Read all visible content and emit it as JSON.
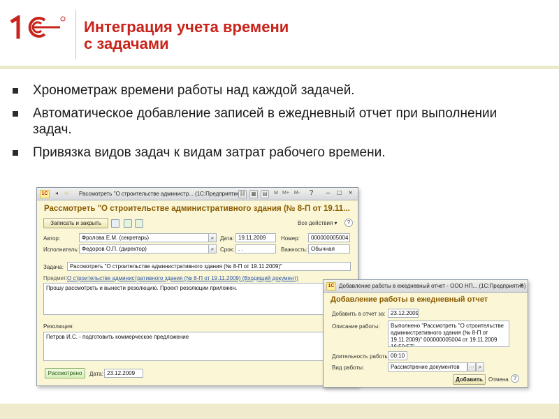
{
  "header": {
    "logo_text": "1С",
    "title_line1": "Интеграция учета времени",
    "title_line2": "с задачами",
    "brand_color": "#c9241b"
  },
  "bullets": [
    "Хронометраж времени работы над каждой задачей.",
    "Автоматическое добавление записей в ежедневный отчет при выполнении задач.",
    "Привязка видов задач к видам затрат рабочего времени."
  ],
  "window1": {
    "titlebar": "Рассмотреть \"О строительстве администр... (1С:Предприятие)",
    "form_title": "Рассмотреть \"О строительстве административного здания (№ 8-П от 19.11...",
    "save_close_label": "Записать и закрыть",
    "all_actions_label": "Все действия",
    "author_label": "Автор:",
    "author_value": "Фролова Е.М. (секретарь)",
    "date_label": "Дата:",
    "date_value": "19.11.2009",
    "number_label": "Номер:",
    "number_value": "000000005004",
    "executor_label": "Исполнитель:",
    "executor_value": "Федоров О.П. (директор)",
    "deadline_label": "Срок:",
    "deadline_value": " .  .",
    "importance_label": "Важность:",
    "importance_value": "Обычная",
    "task_label": "Задача:",
    "task_value": "Рассмотреть \"О строительстве административного здания (№ 8-П от 19.11.2009)\"",
    "subject_label": "Предмет:",
    "subject_link": "О строительстве административного здания (№ 8-П от 19.11.2009) (Входящий документ)",
    "description": "Прошу рассмотреть и вынести резолюцию. Проект резолюции приложен.",
    "resolution_label": "Резолюция:",
    "resolution_value": "Петров И.С. - подготовить коммерческое предложение",
    "reviewed_label": "Рассмотрено",
    "bottom_date_label": "Дата:",
    "bottom_date_value": "23.12.2009"
  },
  "window2": {
    "titlebar": "Добавление работы в ежедневный отчет - ООО НП...  (1С:Предприятие)",
    "form_title": "Добавление работы в ежедневный отчет",
    "add_to_report_label": "Добавить в отчет за:",
    "add_to_report_value": "23.12.2009",
    "work_desc_label": "Описание работы:",
    "work_desc_value": "Выполнено \"Рассмотреть \"О строительстве административного здания (№ 8-П от 19.11.2009)\" 000000005004 от 19.11.2009 16:50:57\"",
    "duration_label": "Длительность работы:",
    "duration_value": "00:10",
    "work_type_label": "Вид работы:",
    "work_type_value": "Рассмотрение документов",
    "add_button_label": "Добавить",
    "cancel_label": "Отмена"
  }
}
